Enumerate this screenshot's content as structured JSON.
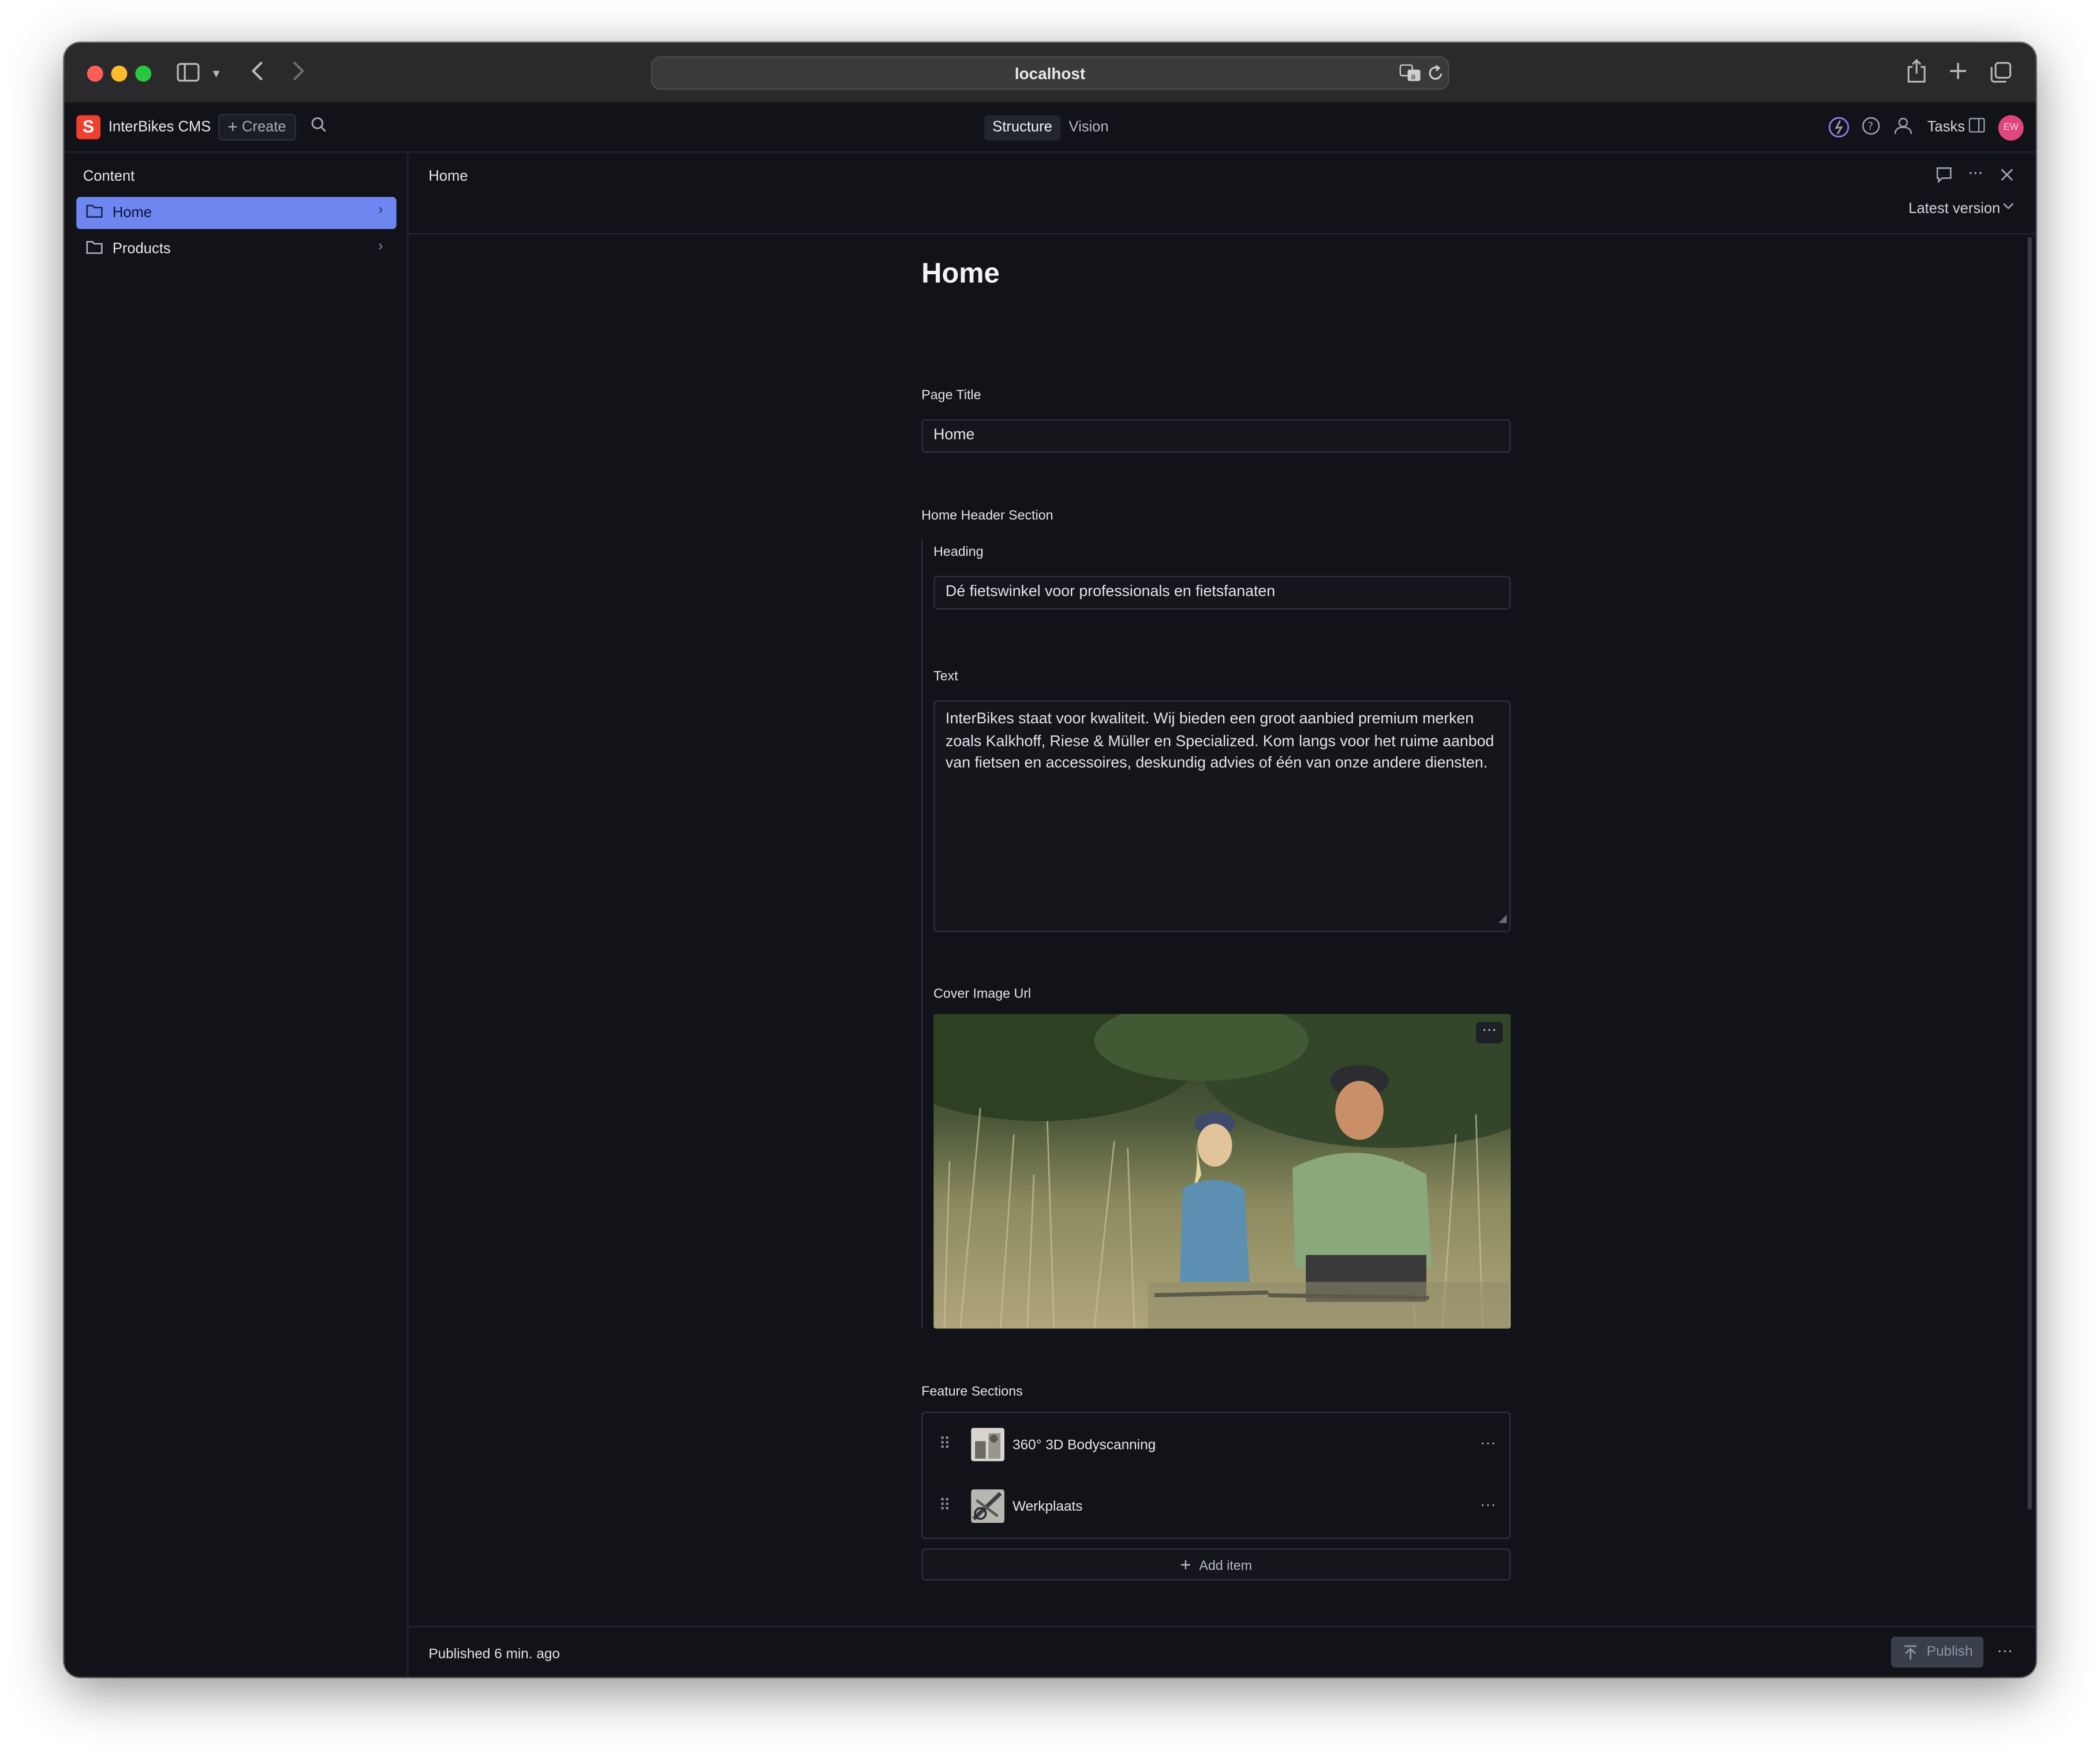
{
  "browser": {
    "url": "localhost",
    "icons": [
      "sidebar-icon",
      "chevron-down-icon",
      "back-icon",
      "forward-icon",
      "translate-icon",
      "reload-icon",
      "share-icon",
      "new-tab-icon",
      "tabs-overview-icon"
    ]
  },
  "navbar": {
    "logo_letter": "S",
    "brand": "InterBikes CMS",
    "create_label": "Create",
    "tools": [
      "Structure",
      "Vision"
    ],
    "active_tool": "Structure",
    "tasks_label": "Tasks",
    "avatar_initials": "EW"
  },
  "structure": {
    "title": "Content",
    "items": [
      {
        "label": "Home",
        "selected": true
      },
      {
        "label": "Products",
        "selected": false
      }
    ]
  },
  "document": {
    "breadcrumb": "Home",
    "version_label": "Latest version",
    "title": "Home",
    "page_title_label": "Page Title",
    "page_title_value": "Home",
    "header_section_label": "Home Header Section",
    "heading_label": "Heading",
    "heading_value": "Dé fietswinkel voor professionals en fietsfanaten",
    "text_label": "Text",
    "text_value": "InterBikes staat voor kwaliteit. Wij bieden een groot aanbied premium merken zoals Kalkhoff, Riese & Müller en Specialized. Kom langs voor het ruime aanbod van fietsen en accessoires, deskundig advies of één van onze andere diensten.",
    "cover_label": "Cover Image Url",
    "feature_label": "Feature Sections",
    "features": [
      {
        "label": "360° 3D Bodyscanning"
      },
      {
        "label": "Werkplaats"
      }
    ],
    "add_item_label": "Add item"
  },
  "footer": {
    "status": "Published 6 min. ago",
    "publish_label": "Publish"
  },
  "colors": {
    "accent": "#6e86f0",
    "background": "#111318",
    "brand_logo": "#f03e2f",
    "avatar": "#e0457b"
  }
}
